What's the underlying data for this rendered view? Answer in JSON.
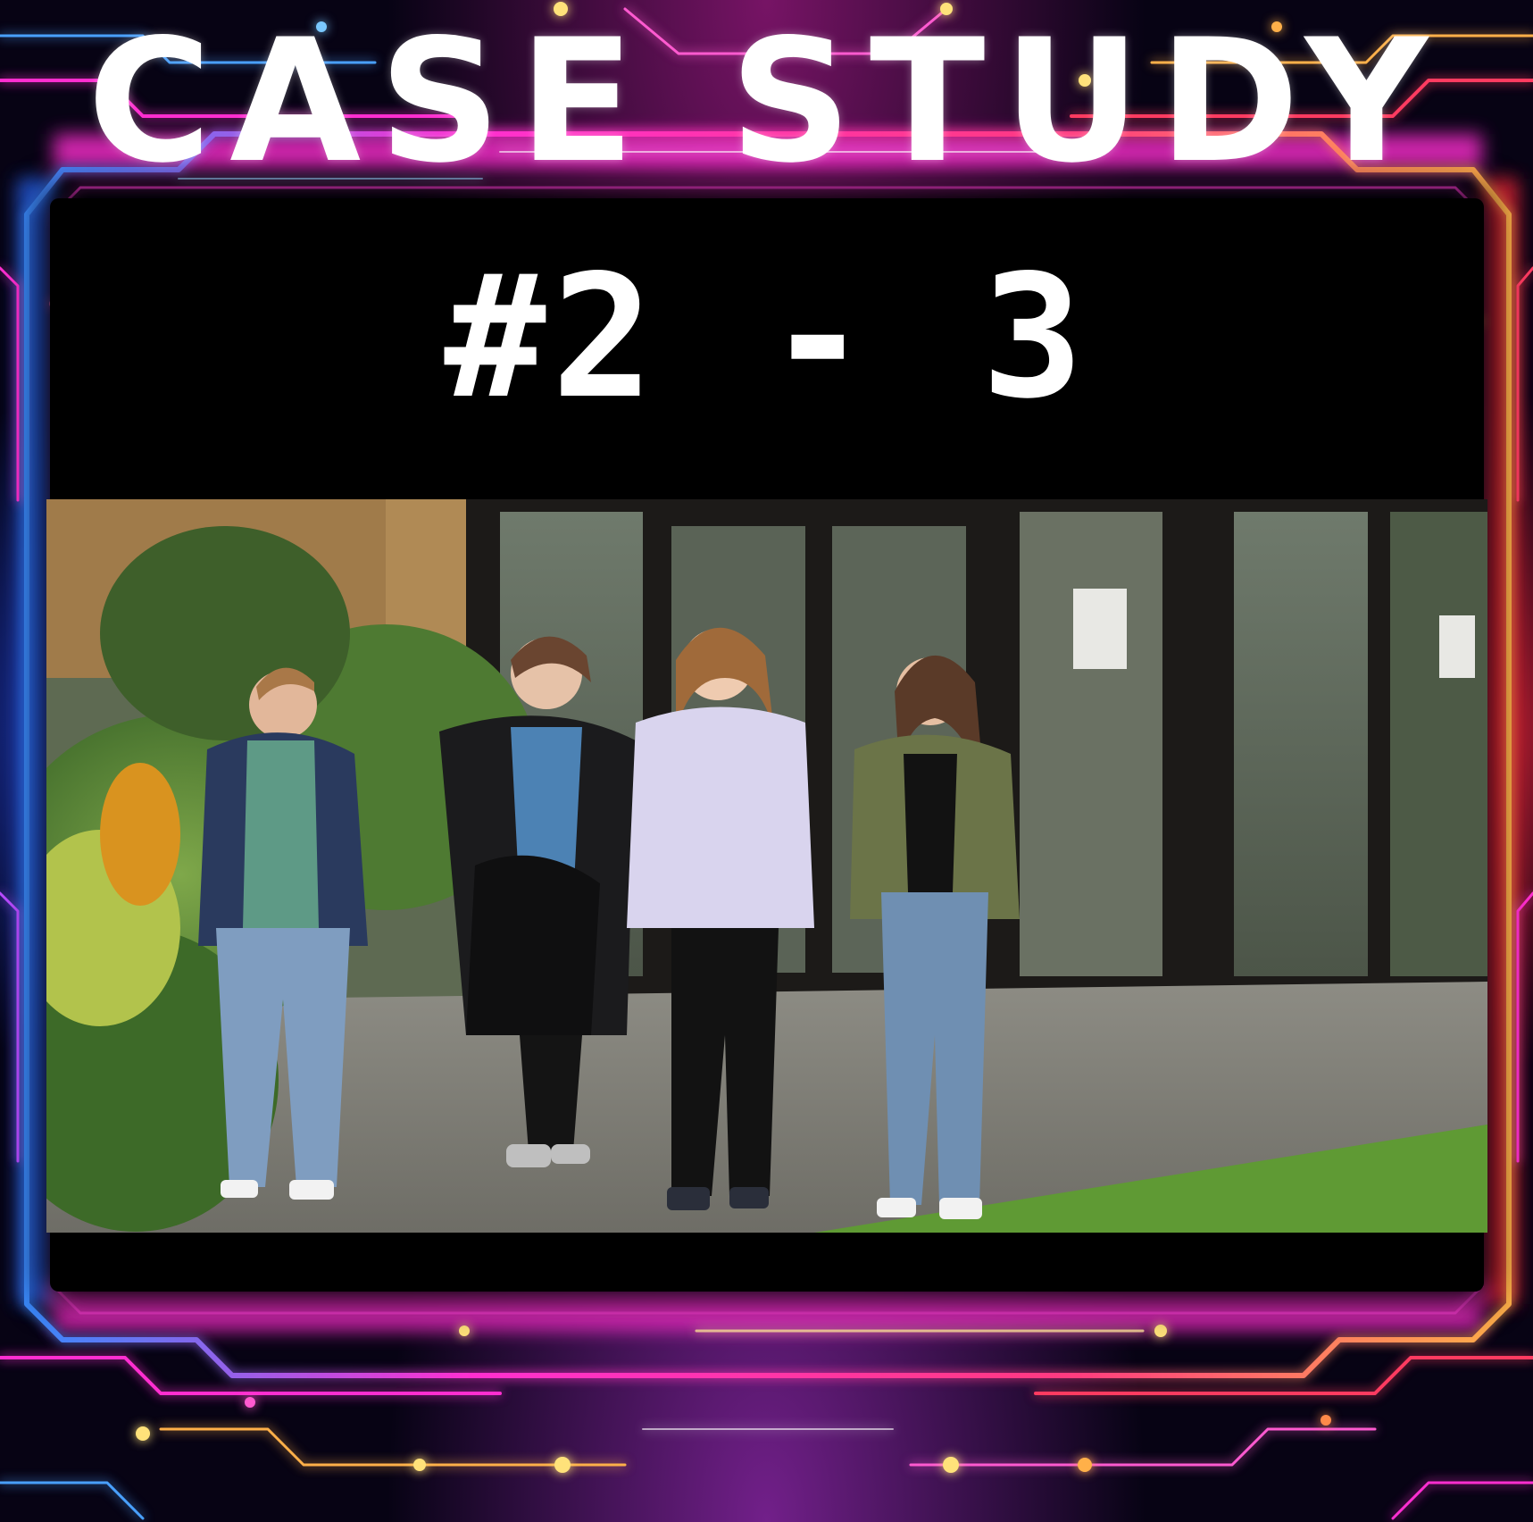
{
  "poster": {
    "title": "CASE STUDY",
    "subtitle": "#2 - 3"
  },
  "photo": {
    "alt": "Four students walking out of a glass-fronted building"
  },
  "colors": {
    "frame_pink": "#ff2fd0",
    "frame_blue": "#2b6bff",
    "frame_red": "#ff2a3a",
    "frame_gold": "#ffd36a",
    "panel_bg": "#000000",
    "text": "#ffffff"
  }
}
